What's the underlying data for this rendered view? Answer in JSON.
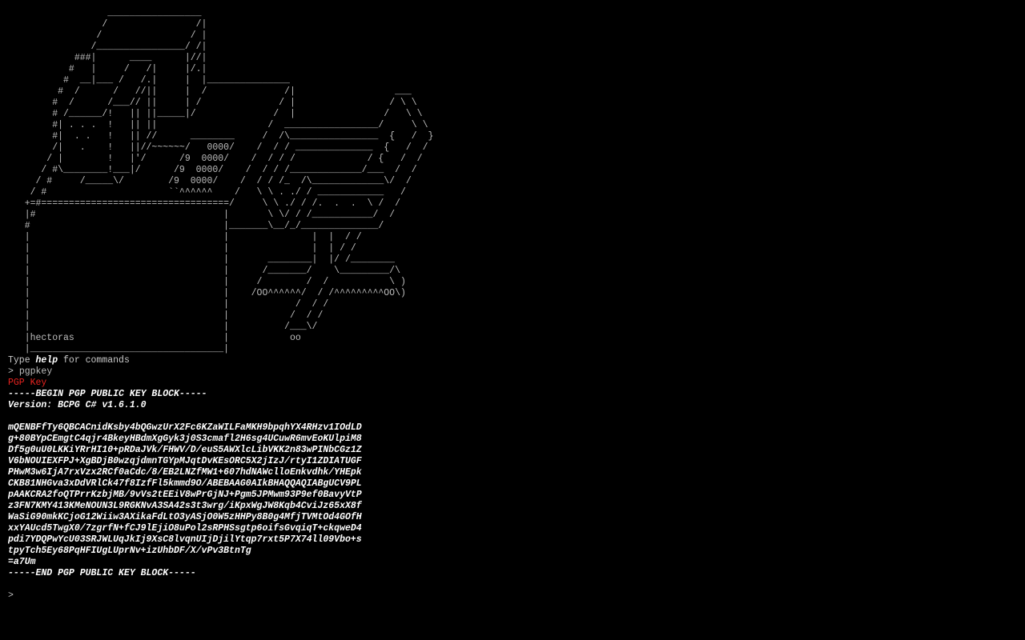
{
  "colors": {
    "background": "#000000",
    "text": "#c8c8c8",
    "highlight": "#ffffff",
    "heading_red": "#e8231f"
  },
  "banner": {
    "art_lines": [
      "                  _________________",
      "                 /                /|",
      "                /                / |",
      "               /________________/ /|",
      "            ###|      ____      |//|",
      "           #   |     /   /|     |/.|",
      "          #  __|___ /   /.|     |  |_______________",
      "         #  /      /   //||     |  /              /|                  ___",
      "        #  /      /___// ||     | /              / |                 / \\ \\",
      "        # /______/!   || ||_____|/              /  |                /   \\ \\",
      "        #| . . .  !   || ||                    /  _________________/     \\ \\",
      "        #|  . .   !   || //      ________     /  /\\________________  {   /  }",
      "        /|   .    !   ||//~~~~~~/   0000/    /  / / ______________  {   /  /",
      "       / |        !   |'/      /9  0000/    /  / / /             / {   /  /",
      "      / #\\________!___|/      /9  0000/    /  / / /_____________/___  /  /",
      "     / #     /_____\\/        /9  0000/    /  / / /_  /\\_____________\\/  /",
      "    / #                      ``^^^^^^    /   \\ \\ . ./ / ____________   /",
      "   +=#==================================/     \\ \\ ./ / /.  .  .  \\ /  /",
      "   |#                                  |       \\ \\/ / /___________/  /",
      "   #                                   |_______\\__/_/______________/",
      "   |                                   |               |  |  / /",
      "   |                                   |               |  | / /",
      "   |                                   |       ________|  |/ /________",
      "   |                                   |      /_______/    \\_________/\\",
      "   |                                   |     /        /  /           \\ )",
      "   |                                   |    /OO^^^^^^/  / /^^^^^^^^^OO\\)",
      "   |                                   |            /  / /",
      "   |                                   |           /  / /",
      "   |                                   |          /___\\/",
      "   |hectoras                           |           oo",
      "   |___________________________________|"
    ]
  },
  "session": {
    "help_prefix": "Type ",
    "help_keyword": "help",
    "help_suffix": " for commands",
    "command_prompt": "> ",
    "command_entered": "pgpkey",
    "output_title": "PGP Key",
    "key_lines": [
      "-----BEGIN PGP PUBLIC KEY BLOCK-----",
      "Version: BCPG C# v1.6.1.0",
      "",
      "mQENBFfTy6QBCACnidKsby4bQGwzUrX2Fc6KZaWILFaMKH9bpqhYX4RHzv1IOdLD",
      "g+80BYpCEmgtC4qjr4BkeyHBdmXgGyk3j0S3cmafl2H6sg4UCuwR6mvEoKUlpiM8",
      "Df5g0uU0LKKiYRrHI10+pRDaJVk/FHWV/D/euS5AWXlcLibVKK2n83wPINbCGz1Z",
      "V6bNOUIEXFPJ+XgBDjB0wzqjdmnTGYpMJqtDvKEsORC5X2jIzJ/rtyI1ZDIATUGF",
      "PHwM3w6IjA7rxVzx2RCf0aCdc/8/EB2LNZfMW1+607hdNAWclloEnkvdhk/YHEpk",
      "CKB81NHGva3xDdVRlCk47f8IzfFl5kmmd9O/ABEBAAG0AIkBHAQQAQIABgUCV9PL",
      "pAAKCRA2foQTPrrKzbjMB/9vVs2tEEiV8wPrGjNJ+Pgm5JPMwm93P9ef0BavyVtP",
      "z3FN7KMY413KMeNOUN3L9RGKNvA3SA42s3t3wrg/iKpxWgJW8Kqb4CviJz65xX8f",
      "WaSiG90mkKCjoG12Wiiw3AXikaFdLtO3yASjO0W5zHHPy8B0g4MfjTVMtOd4GOfH",
      "xxYAUcd5TwgX0/7zgrfN+fCJ9lEjiO8uPol2sRPHSsgtp6oifsGvqiqT+ckqweD4",
      "pdi7YDQPwYcU03SRJWLUqJkIj9XsC8lvqnUIjDjilYtqp7rxt5P7X74ll09Vbo+s",
      "tpyTch5Ey68PqHFIUgLUprNv+izUhbDF/X/vPv3BtnTg",
      "=a7Um",
      "-----END PGP PUBLIC KEY BLOCK-----"
    ],
    "input_prompt": ">",
    "input_value": ""
  }
}
